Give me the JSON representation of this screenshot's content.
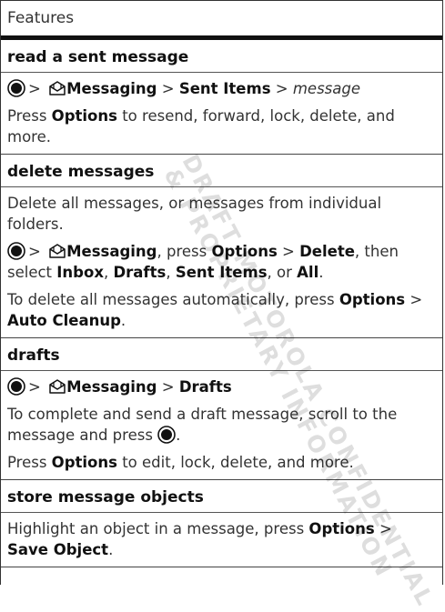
{
  "header": {
    "title": "Features"
  },
  "sections": [
    {
      "title": "read a sent message",
      "paragraphs": [
        [
          "> ",
          {
            "b": "Messaging"
          },
          " > ",
          {
            "b": "Sent Items"
          },
          " > ",
          {
            "i": "message"
          }
        ],
        [
          "Press ",
          {
            "b": "Options"
          },
          " to resend, forward, lock, delete, and more."
        ]
      ]
    },
    {
      "title": "delete messages",
      "paragraphs": [
        [
          "Delete all messages, or messages from individual folders."
        ],
        [
          "> ",
          {
            "b": "Messaging"
          },
          ", press ",
          {
            "b": "Options"
          },
          " > ",
          {
            "b": "Delete"
          },
          ", then select ",
          {
            "b": "Inbox"
          },
          ", ",
          {
            "b": "Drafts"
          },
          ", ",
          {
            "b": "Sent Items"
          },
          ", or ",
          {
            "b": "All"
          },
          "."
        ],
        [
          "To delete all messages automatically, press ",
          {
            "b": "Options"
          },
          " > ",
          {
            "b": "Auto Cleanup"
          },
          "."
        ]
      ]
    },
    {
      "title": "drafts",
      "paragraphs": [
        [
          "> ",
          {
            "b": "Messaging"
          },
          " > ",
          {
            "b": "Drafts"
          }
        ],
        [
          "To complete and send a draft message, scroll to the message and press ",
          {
            "icon": "navkey"
          },
          "."
        ],
        [
          "Press ",
          {
            "b": "Options"
          },
          " to edit, lock, delete, and more."
        ]
      ]
    },
    {
      "title": "store message objects",
      "paragraphs": [
        [
          "Highlight an object in a message, press ",
          {
            "b": "Options"
          },
          " > ",
          {
            "b": "Save Object"
          },
          "."
        ]
      ]
    }
  ],
  "icons": {
    "nav_key": "center-select-key-icon",
    "messaging": "messaging-envelope-icon"
  },
  "watermark": {
    "line1": "DRAFT MOTOROLA CONFIDENTIAL",
    "line2": "& PROPRIETARY INFORMATION"
  }
}
